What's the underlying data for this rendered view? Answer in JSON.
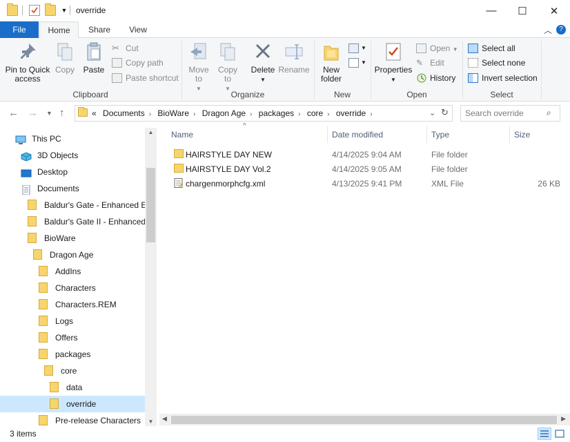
{
  "window": {
    "title": "override",
    "minimize": "—",
    "maximize": "☐",
    "close": "✕"
  },
  "tabs": [
    {
      "label": "File"
    },
    {
      "label": "Home"
    },
    {
      "label": "Share"
    },
    {
      "label": "View"
    }
  ],
  "ribbon": {
    "clipboard": {
      "label": "Clipboard",
      "pin": "Pin to Quick access",
      "copy": "Copy",
      "paste": "Paste",
      "cut": "Cut",
      "copy_path": "Copy path",
      "paste_shortcut": "Paste shortcut"
    },
    "organize": {
      "label": "Organize",
      "move_to": "Move to",
      "copy_to": "Copy to",
      "delete": "Delete",
      "rename": "Rename"
    },
    "new": {
      "label": "New",
      "new_folder": "New folder"
    },
    "open": {
      "label": "Open",
      "properties": "Properties",
      "open": "Open",
      "edit": "Edit",
      "history": "History"
    },
    "select": {
      "label": "Select",
      "select_all": "Select all",
      "select_none": "Select none",
      "invert": "Invert selection"
    }
  },
  "address": {
    "overflow": "«",
    "crumbs": [
      "Documents",
      "BioWare",
      "Dragon Age",
      "packages",
      "core",
      "override"
    ]
  },
  "search": {
    "placeholder": "Search override"
  },
  "tree": [
    {
      "label": "This PC",
      "icon": "pc-icon"
    },
    {
      "label": "3D Objects",
      "icon": "3d-objects-icon"
    },
    {
      "label": "Desktop",
      "icon": "desktop-icon"
    },
    {
      "label": "Documents",
      "icon": "documents-icon"
    },
    {
      "label": "Baldur's Gate - Enhanced Ed",
      "icon": "folder-icon"
    },
    {
      "label": "Baldur's Gate II - Enhanced E",
      "icon": "folder-icon"
    },
    {
      "label": "BioWare",
      "icon": "folder-icon"
    },
    {
      "label": "Dragon Age",
      "icon": "folder-icon"
    },
    {
      "label": "AddIns",
      "icon": "folder-icon"
    },
    {
      "label": "Characters",
      "icon": "folder-icon"
    },
    {
      "label": "Characters.REM",
      "icon": "folder-icon"
    },
    {
      "label": "Logs",
      "icon": "folder-icon"
    },
    {
      "label": "Offers",
      "icon": "folder-icon"
    },
    {
      "label": "packages",
      "icon": "folder-icon"
    },
    {
      "label": "core",
      "icon": "folder-icon"
    },
    {
      "label": "data",
      "icon": "folder-icon"
    },
    {
      "label": "override",
      "icon": "folder-icon",
      "selected": true
    },
    {
      "label": "Pre-release Characters",
      "icon": "folder-icon"
    }
  ],
  "columns": {
    "name": "Name",
    "date": "Date modified",
    "type": "Type",
    "size": "Size"
  },
  "files": [
    {
      "name": "HAIRSTYLE DAY NEW",
      "date": "4/14/2025 9:04 AM",
      "type": "File folder",
      "size": "",
      "icon": "folder-icon"
    },
    {
      "name": "HAIRSTYLE DAY Vol.2",
      "date": "4/14/2025 9:05 AM",
      "type": "File folder",
      "size": "",
      "icon": "folder-icon"
    },
    {
      "name": "chargenmorphcfg.xml",
      "date": "4/13/2025 9:41 PM",
      "type": "XML File",
      "size": "26 KB",
      "icon": "xml-file-icon"
    }
  ],
  "status": {
    "items": "3 items"
  }
}
